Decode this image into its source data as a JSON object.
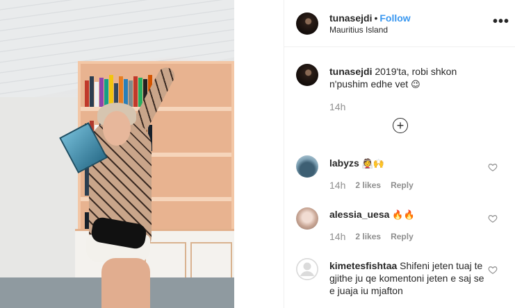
{
  "post": {
    "author": {
      "username": "tunasejdi",
      "separator": "•",
      "follow_label": "Follow",
      "location": "Mauritius Island",
      "avatar_icon": "profile-avatar"
    },
    "more_label": "•••",
    "caption": {
      "username": "tunasejdi",
      "text": "2019'ta, robi shkon n'pushim edhe vet",
      "emoji": "😉",
      "time": "14h"
    },
    "load_more_icon": "plus-circle-icon",
    "load_more_symbol": "+",
    "comments": [
      {
        "username": "labyzs",
        "text": "",
        "emoji": "👰🙌",
        "time": "14h",
        "likes": "2 likes",
        "reply": "Reply",
        "avatar_color": "#5b7f94"
      },
      {
        "username": "alessia_uesa",
        "text": "",
        "emoji": "🔥🔥",
        "time": "14h",
        "likes": "2 likes",
        "reply": "Reply",
        "avatar_color": "#d9c6bf"
      },
      {
        "username": "kimetesfishtaa",
        "text": "Shifeni jeten tuaj te gjithe ju qe komentoni jeten e saj se e juaja iu mjafton",
        "emoji": "",
        "time": "",
        "likes": "",
        "reply": "",
        "avatar_color": "#dbdbdb"
      }
    ]
  },
  "colors": {
    "link_blue": "#3897f0",
    "text_primary": "#262626",
    "text_secondary": "#8e8e8e",
    "border": "#efefef"
  }
}
